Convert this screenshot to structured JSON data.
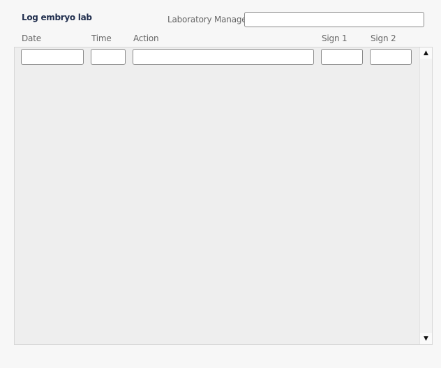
{
  "title": "Log embryo lab",
  "manager": {
    "label": "Laboratory Manager",
    "value": ""
  },
  "columns": [
    "Date",
    "Time",
    "Action",
    "Sign 1",
    "Sign 2"
  ],
  "rows": [
    {
      "date": "",
      "time": "",
      "action": "",
      "sign1": "",
      "sign2": ""
    }
  ],
  "scrollbar": {
    "up_icon": "▲",
    "down_icon": "▼"
  }
}
